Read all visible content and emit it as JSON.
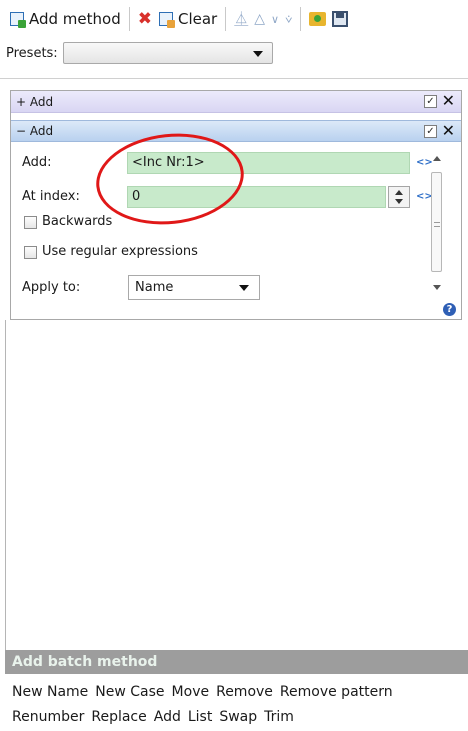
{
  "toolbar": {
    "add_method_label": "Add method",
    "clear_label": "Clear",
    "icons": [
      "add-method-icon",
      "remove-icon",
      "clear-icon",
      "move-up-icon",
      "move-down-icon",
      "load-icon",
      "save-icon"
    ]
  },
  "presets": {
    "label": "Presets:",
    "value": ""
  },
  "methods": [
    {
      "header": "+ Add",
      "enabled": true
    },
    {
      "header": "− Add",
      "enabled": true
    }
  ],
  "add_method": {
    "add_label": "Add:",
    "add_value": "<Inc Nr:1>",
    "at_index_label": "At index:",
    "at_index_value": "0",
    "backwards_label": "Backwards",
    "backwards_checked": false,
    "regex_label": "Use regular expressions",
    "regex_checked": false,
    "apply_to_label": "Apply to:",
    "apply_to_value": "Name"
  },
  "batch": {
    "title": "Add batch method",
    "row1": [
      "New Name",
      "New Case",
      "Move",
      "Remove",
      "Remove pattern"
    ],
    "row2": [
      "Renumber",
      "Replace",
      "Add",
      "List",
      "Swap",
      "Trim"
    ]
  },
  "colors": {
    "field_bg": "#c8eacb",
    "annotation_circle": "#e01818",
    "batch_header_bg": "#9d9d9d"
  }
}
